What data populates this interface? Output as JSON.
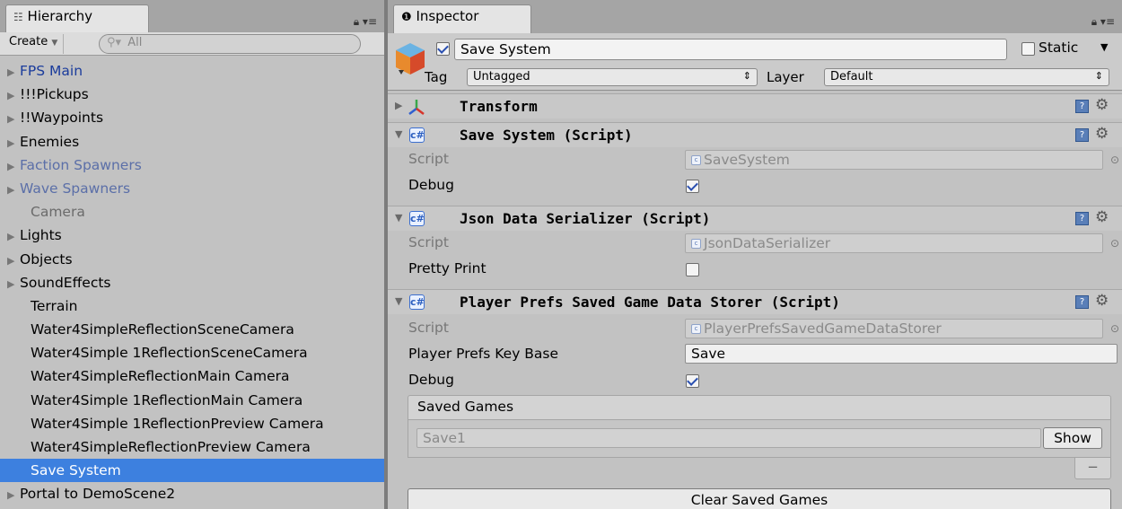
{
  "hierarchy": {
    "tab_label": "Hierarchy",
    "create_label": "Create",
    "search_placeholder": "All",
    "items": [
      {
        "label": "FPS Main",
        "arrow": true,
        "style": "prefab"
      },
      {
        "label": "!!!Pickups",
        "arrow": true,
        "style": "normal"
      },
      {
        "label": "!!Waypoints",
        "arrow": true,
        "style": "normal"
      },
      {
        "label": "Enemies",
        "arrow": true,
        "style": "normal"
      },
      {
        "label": "Faction Spawners",
        "arrow": true,
        "style": "prefab-dim"
      },
      {
        "label": "Wave Spawners",
        "arrow": true,
        "style": "prefab-dim"
      },
      {
        "label": "Camera",
        "arrow": false,
        "style": "inactive"
      },
      {
        "label": "Lights",
        "arrow": true,
        "style": "normal"
      },
      {
        "label": "Objects",
        "arrow": true,
        "style": "normal"
      },
      {
        "label": "SoundEffects",
        "arrow": true,
        "style": "normal"
      },
      {
        "label": "Terrain",
        "arrow": false,
        "style": "normal"
      },
      {
        "label": "Water4SimpleReflectionSceneCamera",
        "arrow": false,
        "style": "normal"
      },
      {
        "label": "Water4Simple 1ReflectionSceneCamera",
        "arrow": false,
        "style": "normal"
      },
      {
        "label": "Water4SimpleReflectionMain Camera",
        "arrow": false,
        "style": "normal"
      },
      {
        "label": "Water4Simple 1ReflectionMain Camera",
        "arrow": false,
        "style": "normal"
      },
      {
        "label": "Water4Simple 1ReflectionPreview Camera",
        "arrow": false,
        "style": "normal"
      },
      {
        "label": "Water4SimpleReflectionPreview Camera",
        "arrow": false,
        "style": "normal"
      },
      {
        "label": "Save System",
        "arrow": false,
        "style": "selected"
      },
      {
        "label": "Portal to DemoScene2",
        "arrow": true,
        "style": "normal"
      }
    ]
  },
  "inspector": {
    "tab_label": "Inspector",
    "object": {
      "name": "Save System",
      "active": true,
      "static_label": "Static",
      "tag_label": "Tag",
      "tag_value": "Untagged",
      "layer_label": "Layer",
      "layer_value": "Default"
    },
    "components": {
      "transform": {
        "title": "Transform"
      },
      "save_system": {
        "title": "Save System (Script)",
        "script_label": "Script",
        "script_value": "SaveSystem",
        "debug_label": "Debug",
        "debug_value": true
      },
      "json_serializer": {
        "title": "Json Data Serializer (Script)",
        "script_label": "Script",
        "script_value": "JsonDataSerializer",
        "pretty_label": "Pretty Print",
        "pretty_value": false
      },
      "player_prefs": {
        "title": "Player Prefs Saved Game Data Storer (Script)",
        "script_label": "Script",
        "script_value": "PlayerPrefsSavedGameDataStorer",
        "key_base_label": "Player Prefs Key Base",
        "key_base_value": "Save",
        "debug_label": "Debug",
        "debug_value": true,
        "saved_games_label": "Saved Games",
        "saved_games": [
          {
            "name": "Save1",
            "button": "Show"
          }
        ],
        "remove_label": "−",
        "clear_label": "Clear Saved Games"
      }
    }
  },
  "colors": {
    "selection": "#3d80df",
    "prefab_text": "#1b3c9c",
    "panel_bg": "#c2c2c2"
  },
  "icons": {
    "hierarchy_tab": "hierarchy-list-icon",
    "inspector_tab": "info-icon",
    "lock": "lock-icon",
    "menu": "panel-menu-icon",
    "component_script": "csharp-script-icon",
    "transform": "transform-axes-icon",
    "help": "help-book-icon",
    "gear": "gear-icon"
  }
}
